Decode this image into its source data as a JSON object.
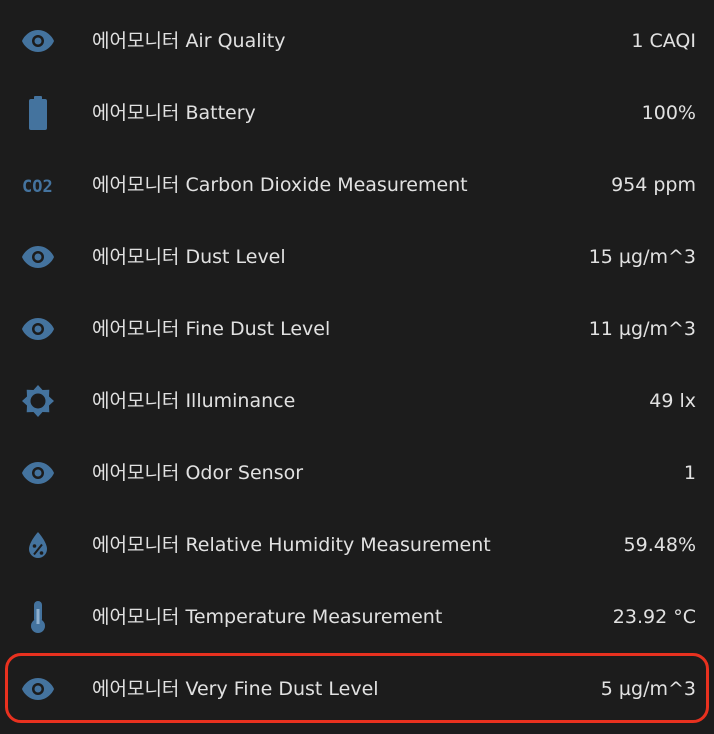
{
  "accent_color": "#44739e",
  "highlight_color": "#e8311f",
  "entities": [
    {
      "name": "에어모니터 Air Quality",
      "value": "1 CAQI",
      "icon": "eye-icon"
    },
    {
      "name": "에어모니터 Battery",
      "value": "100%",
      "icon": "battery-icon"
    },
    {
      "name": "에어모니터 Carbon Dioxide Measurement",
      "value": "954 ppm",
      "icon": "co2-icon",
      "icon_text": "CO2"
    },
    {
      "name": "에어모니터 Dust Level",
      "value": "15 µg/m^3",
      "icon": "eye-icon"
    },
    {
      "name": "에어모니터 Fine Dust Level",
      "value": "11 µg/m^3",
      "icon": "eye-icon"
    },
    {
      "name": "에어모니터 Illuminance",
      "value": "49 lx",
      "icon": "brightness-icon"
    },
    {
      "name": "에어모니터 Odor Sensor",
      "value": "1",
      "icon": "eye-icon"
    },
    {
      "name": "에어모니터 Relative Humidity Measurement",
      "value": "59.48%",
      "icon": "water-percent-icon"
    },
    {
      "name": "에어모니터 Temperature Measurement",
      "value": "23.92 °C",
      "icon": "thermometer-icon"
    },
    {
      "name": "에어모니터 Very Fine Dust Level",
      "value": "5 µg/m^3",
      "icon": "eye-icon",
      "highlighted": true
    }
  ]
}
